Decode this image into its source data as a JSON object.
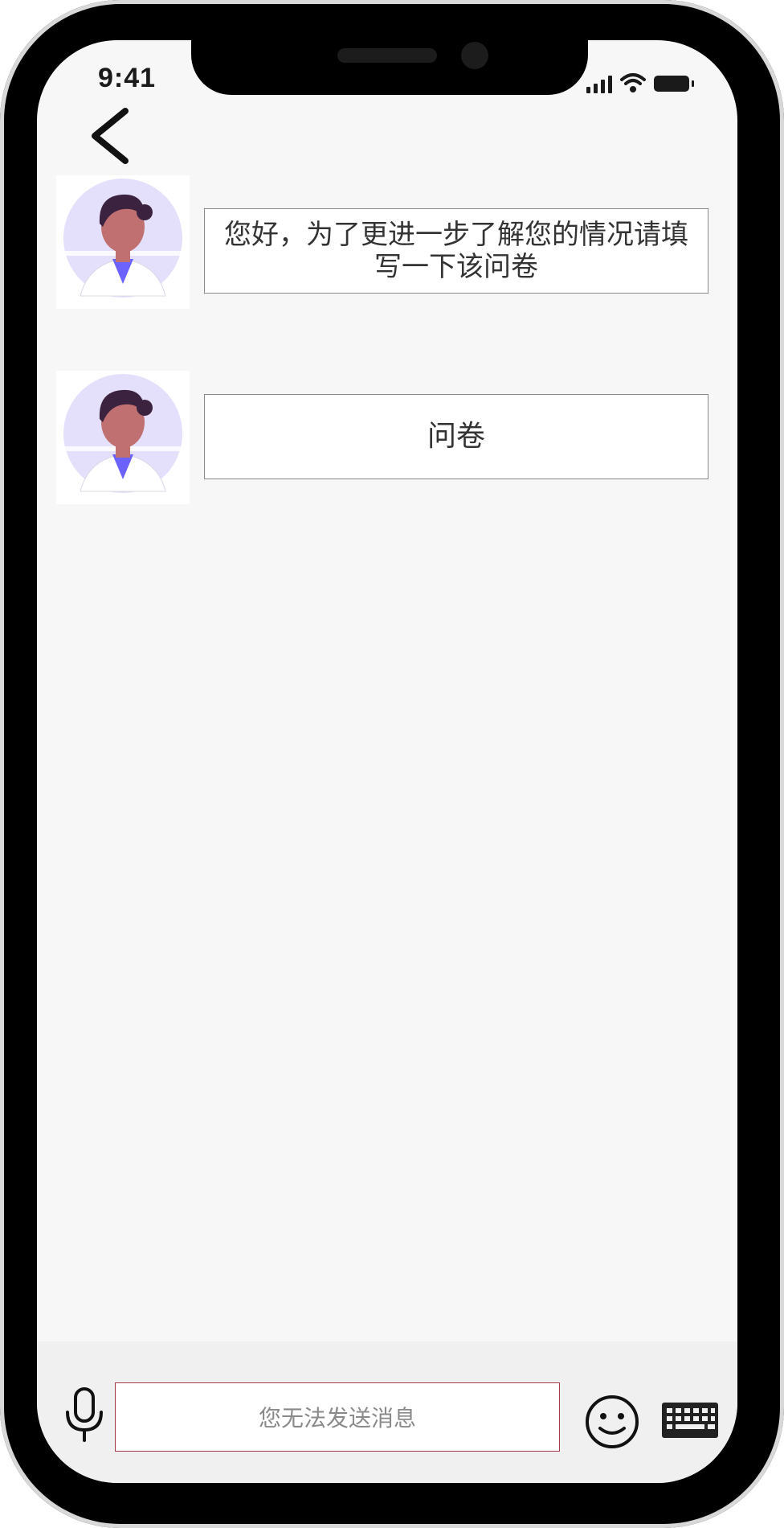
{
  "status_bar": {
    "time": "9:41"
  },
  "messages": [
    {
      "text": "您好，为了更进一步了解您的情况请填写一下该问卷"
    },
    {
      "text": "问卷"
    }
  ],
  "input": {
    "placeholder": "您无法发送消息"
  },
  "icons": {
    "back": "back-arrow-icon",
    "mic": "microphone-icon",
    "emoji": "emoji-icon",
    "keyboard": "keyboard-icon"
  },
  "colors": {
    "input_border": "#a33a4a",
    "avatar_bg": "#e4e0fb",
    "avatar_accent": "#6c63ff"
  }
}
